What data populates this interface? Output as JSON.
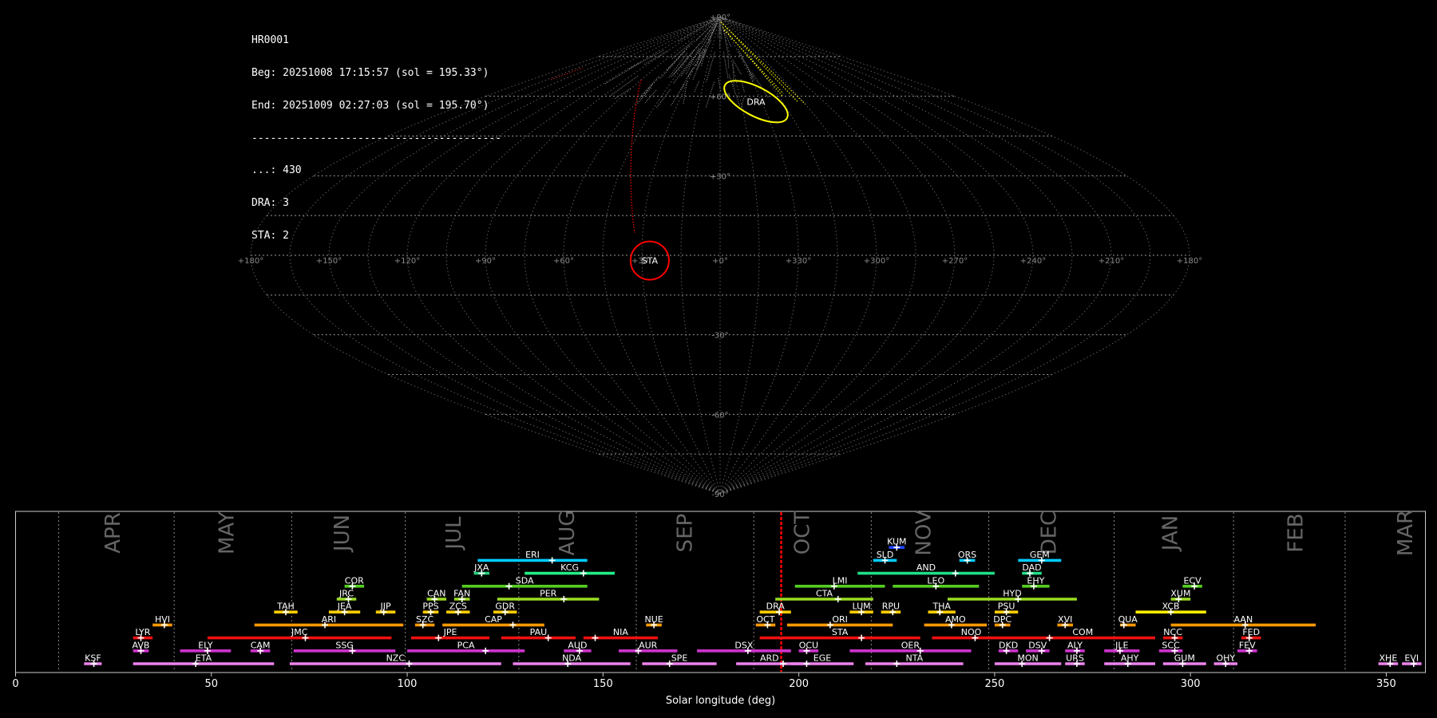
{
  "info": {
    "lines": [
      "HR0001",
      "Beg: 20251008 17:15:57 (sol = 195.33°)",
      "End: 20251009 02:27:03 (sol = 195.70°)",
      "----------------------------------------",
      "...: 430",
      "DRA: 3",
      "STA: 2"
    ]
  },
  "colors": {
    "background": "#000000",
    "grid": "#888888",
    "spo": "#888888",
    "DRA": "#ffff00",
    "STA": "#ff0000",
    "sol_marker": "#ff0000"
  },
  "chart_data": [
    {
      "type": "scatter",
      "projection": "sinusoidal",
      "title": "",
      "lon_labels": [
        "+180°",
        "+150°",
        "+120°",
        "+90°",
        "+60°",
        "+30°",
        "+0°",
        "+330°",
        "+300°",
        "+270°",
        "+240°",
        "+210°",
        "+180°"
      ],
      "lat_labels": [
        {
          "lat": 90,
          "label": "+90°"
        },
        {
          "lat": 60,
          "label": "+60°"
        },
        {
          "lat": 30,
          "label": "+30°"
        },
        {
          "lat": -30,
          "label": "-30°"
        },
        {
          "lat": -60,
          "label": "-60°"
        },
        {
          "lat": -90,
          "label": "-90°"
        }
      ],
      "radiants": [
        {
          "name": "DRA",
          "lon": 334,
          "lat": 58
        },
        {
          "name": "STA",
          "lon": 27,
          "lat": -2
        }
      ]
    },
    {
      "type": "gantt",
      "xlabel": "Solar longitude (deg)",
      "xlim": [
        0,
        360
      ],
      "xticks": [
        0,
        50,
        100,
        150,
        200,
        250,
        300,
        350
      ],
      "month_boundaries": [
        11,
        40.5,
        70.5,
        99.5,
        128.5,
        158.5,
        188.5,
        218.5,
        248.5,
        280.5,
        311,
        339.5
      ],
      "months": [
        {
          "name": "APR",
          "sol": 25
        },
        {
          "name": "MAY",
          "sol": 54
        },
        {
          "name": "JUN",
          "sol": 83.5
        },
        {
          "name": "JUL",
          "sol": 112
        },
        {
          "name": "AUG",
          "sol": 141
        },
        {
          "name": "SEP",
          "sol": 171
        },
        {
          "name": "OCT",
          "sol": 201
        },
        {
          "name": "NOV",
          "sol": 232
        },
        {
          "name": "DEC",
          "sol": 264
        },
        {
          "name": "JAN",
          "sol": 295
        },
        {
          "name": "FEB",
          "sol": 327
        },
        {
          "name": "MAR",
          "sol": 355
        }
      ],
      "current_sol": 195.5,
      "showers": [
        {
          "code": "KSF",
          "start": 17.5,
          "end": 22,
          "peak": 20,
          "row": 0,
          "color": "#ee82ee"
        },
        {
          "code": "ETA",
          "start": 30,
          "end": 66,
          "peak": 46,
          "row": 0,
          "color": "#ee82ee"
        },
        {
          "code": "NZC",
          "start": 70,
          "end": 124,
          "peak": 100.5,
          "row": 0,
          "color": "#ee82ee"
        },
        {
          "code": "NDA",
          "start": 127,
          "end": 157,
          "peak": 141,
          "row": 0,
          "color": "#ee82ee"
        },
        {
          "code": "SPE",
          "start": 160,
          "end": 179,
          "peak": 167,
          "row": 0,
          "color": "#ee82ee"
        },
        {
          "code": "ARD",
          "start": 184,
          "end": 201,
          "peak": 196,
          "row": 0,
          "color": "#ee82ee"
        },
        {
          "code": "EGE",
          "start": 198,
          "end": 214,
          "peak": 202,
          "row": 0,
          "color": "#ee82ee"
        },
        {
          "code": "NTA",
          "start": 217,
          "end": 242,
          "peak": 225,
          "row": 0,
          "color": "#ee82ee"
        },
        {
          "code": "MON",
          "start": 250,
          "end": 267,
          "peak": 257,
          "row": 0,
          "color": "#ee82ee"
        },
        {
          "code": "URS",
          "start": 268,
          "end": 273,
          "peak": 271,
          "row": 0,
          "color": "#ee82ee"
        },
        {
          "code": "AHY",
          "start": 278,
          "end": 291,
          "peak": 284,
          "row": 0,
          "color": "#ee82ee"
        },
        {
          "code": "GUM",
          "start": 293,
          "end": 304,
          "peak": 298,
          "row": 0,
          "color": "#ee82ee"
        },
        {
          "code": "OHY",
          "start": 306,
          "end": 312,
          "peak": 309,
          "row": 0,
          "color": "#ee82ee"
        },
        {
          "code": "XHE",
          "start": 348,
          "end": 353,
          "peak": 351,
          "row": 0,
          "color": "#ee82ee"
        },
        {
          "code": "EVI",
          "start": 354,
          "end": 359,
          "peak": 357,
          "row": 0,
          "color": "#ee82ee"
        },
        {
          "code": "AVB",
          "start": 30,
          "end": 34,
          "peak": 32,
          "row": 1,
          "color": "#cc33cc"
        },
        {
          "code": "ELY",
          "start": 42,
          "end": 55,
          "peak": 49,
          "row": 1,
          "color": "#cc33cc"
        },
        {
          "code": "CAM",
          "start": 60,
          "end": 65,
          "peak": 62.5,
          "row": 1,
          "color": "#cc33cc"
        },
        {
          "code": "SSG",
          "start": 71,
          "end": 97,
          "peak": 86,
          "row": 1,
          "color": "#cc33cc"
        },
        {
          "code": "PCA",
          "start": 100,
          "end": 130,
          "peak": 120,
          "row": 1,
          "color": "#cc33cc"
        },
        {
          "code": "AUD",
          "start": 140,
          "end": 147,
          "peak": 144,
          "row": 1,
          "color": "#cc33cc"
        },
        {
          "code": "AUR",
          "start": 154,
          "end": 169,
          "peak": 159,
          "row": 1,
          "color": "#cc33cc"
        },
        {
          "code": "DSX",
          "start": 174,
          "end": 198,
          "peak": 187,
          "row": 1,
          "color": "#cc33cc"
        },
        {
          "code": "OCU",
          "start": 200,
          "end": 205,
          "peak": 202,
          "row": 1,
          "color": "#cc33cc"
        },
        {
          "code": "OER",
          "start": 213,
          "end": 244,
          "peak": 231,
          "row": 1,
          "color": "#cc33cc"
        },
        {
          "code": "DKD",
          "start": 251,
          "end": 256,
          "peak": 253,
          "row": 1,
          "color": "#cc33cc"
        },
        {
          "code": "DSV",
          "start": 258,
          "end": 264,
          "peak": 262,
          "row": 1,
          "color": "#cc33cc"
        },
        {
          "code": "ALY",
          "start": 268,
          "end": 273,
          "peak": 271,
          "row": 1,
          "color": "#cc33cc"
        },
        {
          "code": "JLE",
          "start": 278,
          "end": 287,
          "peak": 282,
          "row": 1,
          "color": "#cc33cc"
        },
        {
          "code": "SCC",
          "start": 292,
          "end": 298,
          "peak": 296,
          "row": 1,
          "color": "#cc33cc"
        },
        {
          "code": "FEV",
          "start": 312,
          "end": 317,
          "peak": 315,
          "row": 1,
          "color": "#cc33cc"
        },
        {
          "code": "LYR",
          "start": 30,
          "end": 35,
          "peak": 32,
          "row": 2,
          "color": "#ee1111"
        },
        {
          "code": "JMC",
          "start": 49,
          "end": 96,
          "peak": 74,
          "row": 2,
          "color": "#ee1111"
        },
        {
          "code": "JPE",
          "start": 101,
          "end": 121,
          "peak": 108,
          "row": 2,
          "color": "#ee1111"
        },
        {
          "code": "PAU",
          "start": 124,
          "end": 143,
          "peak": 136,
          "row": 2,
          "color": "#ee1111"
        },
        {
          "code": "NIA",
          "start": 145,
          "end": 164,
          "peak": 148,
          "row": 2,
          "color": "#ee1111"
        },
        {
          "code": "STA",
          "start": 190,
          "end": 231,
          "peak": 216,
          "row": 2,
          "color": "#ee1111"
        },
        {
          "code": "NOO",
          "start": 234,
          "end": 254,
          "peak": 245,
          "row": 2,
          "color": "#ee1111"
        },
        {
          "code": "COM",
          "start": 254,
          "end": 291,
          "peak": 264,
          "row": 2,
          "color": "#ee1111"
        },
        {
          "code": "NCC",
          "start": 293,
          "end": 298,
          "peak": 296,
          "row": 2,
          "color": "#ee1111"
        },
        {
          "code": "FED",
          "start": 313,
          "end": 318,
          "peak": 315,
          "row": 2,
          "color": "#ee1111"
        },
        {
          "code": "HVI",
          "start": 35,
          "end": 40,
          "peak": 38,
          "row": 3,
          "color": "#ff9900"
        },
        {
          "code": "ARI",
          "start": 61,
          "end": 99,
          "peak": 79,
          "row": 3,
          "color": "#ff9900"
        },
        {
          "code": "SZC",
          "start": 102,
          "end": 107,
          "peak": 104,
          "row": 3,
          "color": "#ff9900"
        },
        {
          "code": "CAP",
          "start": 109,
          "end": 135,
          "peak": 127,
          "row": 3,
          "color": "#ff9900"
        },
        {
          "code": "NUE",
          "start": 161,
          "end": 165,
          "peak": 163,
          "row": 3,
          "color": "#ff9900"
        },
        {
          "code": "OCT",
          "start": 189,
          "end": 194,
          "peak": 192,
          "row": 3,
          "color": "#ff9900"
        },
        {
          "code": "ORI",
          "start": 197,
          "end": 224,
          "peak": 208,
          "row": 3,
          "color": "#ff9900"
        },
        {
          "code": "AMO",
          "start": 232,
          "end": 248,
          "peak": 239,
          "row": 3,
          "color": "#ff9900"
        },
        {
          "code": "DPC",
          "start": 250,
          "end": 254,
          "peak": 252,
          "row": 3,
          "color": "#ff9900"
        },
        {
          "code": "XVI",
          "start": 266,
          "end": 270,
          "peak": 268,
          "row": 3,
          "color": "#ff9900"
        },
        {
          "code": "QUA",
          "start": 282,
          "end": 286,
          "peak": 283,
          "row": 3,
          "color": "#ff9900"
        },
        {
          "code": "AAN",
          "start": 295,
          "end": 332,
          "peak": 314,
          "row": 3,
          "color": "#ff9900"
        },
        {
          "code": "TAH",
          "start": 66,
          "end": 72,
          "peak": 69,
          "row": 4,
          "color": "#ffcc00"
        },
        {
          "code": "JEA",
          "start": 80,
          "end": 88,
          "peak": 84,
          "row": 4,
          "color": "#ffcc00"
        },
        {
          "code": "JIP",
          "start": 92,
          "end": 97,
          "peak": 94,
          "row": 4,
          "color": "#ffcc00"
        },
        {
          "code": "PPS",
          "start": 104,
          "end": 108,
          "peak": 106,
          "row": 4,
          "color": "#ffcc00"
        },
        {
          "code": "ZCS",
          "start": 110,
          "end": 116,
          "peak": 113,
          "row": 4,
          "color": "#ffcc00"
        },
        {
          "code": "GDR",
          "start": 122,
          "end": 128,
          "peak": 125,
          "row": 4,
          "color": "#ffcc00"
        },
        {
          "code": "DRA",
          "start": 190,
          "end": 198,
          "peak": 195,
          "row": 4,
          "color": "#ffcc00"
        },
        {
          "code": "LUM",
          "start": 213,
          "end": 219,
          "peak": 216,
          "row": 4,
          "color": "#ffcc00"
        },
        {
          "code": "RPU",
          "start": 221,
          "end": 226,
          "peak": 224,
          "row": 4,
          "color": "#ffcc00"
        },
        {
          "code": "THA",
          "start": 233,
          "end": 240,
          "peak": 236,
          "row": 4,
          "color": "#ffcc00"
        },
        {
          "code": "PSU",
          "start": 250,
          "end": 256,
          "peak": 253,
          "row": 4,
          "color": "#ffcc00"
        },
        {
          "code": "XCB",
          "start": 286,
          "end": 304,
          "peak": 295,
          "row": 4,
          "color": "#ffee00"
        },
        {
          "code": "JRC",
          "start": 82,
          "end": 87,
          "peak": 85,
          "row": 5,
          "color": "#99dd22"
        },
        {
          "code": "CAN",
          "start": 105,
          "end": 110,
          "peak": 107,
          "row": 5,
          "color": "#99dd22"
        },
        {
          "code": "FAN",
          "start": 112,
          "end": 116,
          "peak": 114,
          "row": 5,
          "color": "#99dd22"
        },
        {
          "code": "PER",
          "start": 123,
          "end": 149,
          "peak": 140,
          "row": 5,
          "color": "#99dd22"
        },
        {
          "code": "CTA",
          "start": 194,
          "end": 219,
          "peak": 210,
          "row": 5,
          "color": "#99dd22"
        },
        {
          "code": "HYD",
          "start": 238,
          "end": 271,
          "peak": 256,
          "row": 5,
          "color": "#99dd22"
        },
        {
          "code": "XUM",
          "start": 295,
          "end": 300,
          "peak": 297,
          "row": 5,
          "color": "#99dd22"
        },
        {
          "code": "COR",
          "start": 84,
          "end": 89,
          "peak": 86,
          "row": 6,
          "color": "#55cc22"
        },
        {
          "code": "SDA",
          "start": 114,
          "end": 146,
          "peak": 126,
          "row": 6,
          "color": "#55cc22"
        },
        {
          "code": "LMI",
          "start": 199,
          "end": 222,
          "peak": 209,
          "row": 6,
          "color": "#55cc22"
        },
        {
          "code": "LEO",
          "start": 224,
          "end": 246,
          "peak": 235,
          "row": 6,
          "color": "#55cc22"
        },
        {
          "code": "EHY",
          "start": 257,
          "end": 264,
          "peak": 260,
          "row": 6,
          "color": "#55cc22"
        },
        {
          "code": "ECV",
          "start": 298,
          "end": 303,
          "peak": 301,
          "row": 6,
          "color": "#55cc22"
        },
        {
          "code": "JXA",
          "start": 117,
          "end": 121,
          "peak": 119,
          "row": 7,
          "color": "#22cc77"
        },
        {
          "code": "KCG",
          "start": 130,
          "end": 153,
          "peak": 145,
          "row": 7,
          "color": "#22ee88"
        },
        {
          "code": "AND",
          "start": 215,
          "end": 250,
          "peak": 240,
          "row": 7,
          "color": "#22dd88"
        },
        {
          "code": "DAD",
          "start": 257,
          "end": 262,
          "peak": 259,
          "row": 7,
          "color": "#22dd88"
        },
        {
          "code": "ERI",
          "start": 118,
          "end": 146,
          "peak": 137,
          "row": 8,
          "color": "#00ccff"
        },
        {
          "code": "SLD",
          "start": 219,
          "end": 225,
          "peak": 222,
          "row": 8,
          "color": "#00ccff"
        },
        {
          "code": "ORS",
          "start": 241,
          "end": 245,
          "peak": 243,
          "row": 8,
          "color": "#00ccff"
        },
        {
          "code": "GEM",
          "start": 256,
          "end": 267,
          "peak": 262,
          "row": 8,
          "color": "#00ccff"
        },
        {
          "code": "KUM",
          "start": 223,
          "end": 227,
          "peak": 225,
          "row": 9,
          "color": "#2244ff"
        }
      ]
    }
  ]
}
